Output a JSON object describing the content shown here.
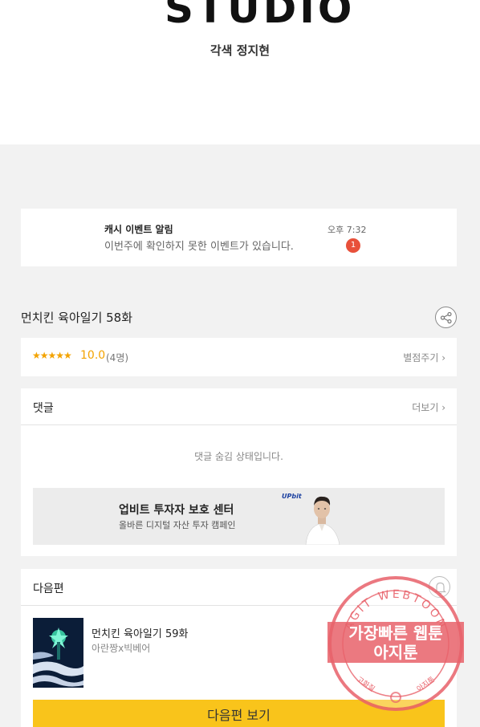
{
  "hero": {
    "studio_logo": "STUDIO",
    "adaptation_credit": "각색 정지현"
  },
  "notification": {
    "title": "캐시 이벤트 알림",
    "message": "이번주에 확인하지 못한 이벤트가 있습니다.",
    "time": "오후 7:32",
    "badge_count": "1"
  },
  "episode": {
    "title": "먼치킨 육아일기 58화",
    "share_icon": "share-icon"
  },
  "rating": {
    "stars": "★★★★★",
    "score": "10.0",
    "count": "(4명)",
    "rate_button": "별점주기 ›"
  },
  "comments": {
    "label": "댓글",
    "more": "더보기 ›",
    "hidden_message": "댓글 숨김 상태입니다."
  },
  "ad": {
    "title": "업비트 투자자 보호 센터",
    "subtitle": "올바른 디지털 자산 투자 캠페인",
    "brand_logo": "UPbit"
  },
  "next_episode": {
    "label": "다음편",
    "episode_title": "먼치킨 육아일기 59화",
    "authors": "아란짱x빅베어",
    "button_label": "다음편 보기",
    "bell_icon": "bell-icon"
  },
  "watermark": {
    "arc_text": "AGIT WEBTOON",
    "line1": "가장빠른 웹툰",
    "line2": "아지툰",
    "bottom_left": "고화질",
    "bottom_right": "아지툰"
  },
  "colors": {
    "accent_yellow": "#f9c41b",
    "star_orange": "#f3a300",
    "badge_red": "#e8503a",
    "stamp_red": "#e8616a"
  }
}
